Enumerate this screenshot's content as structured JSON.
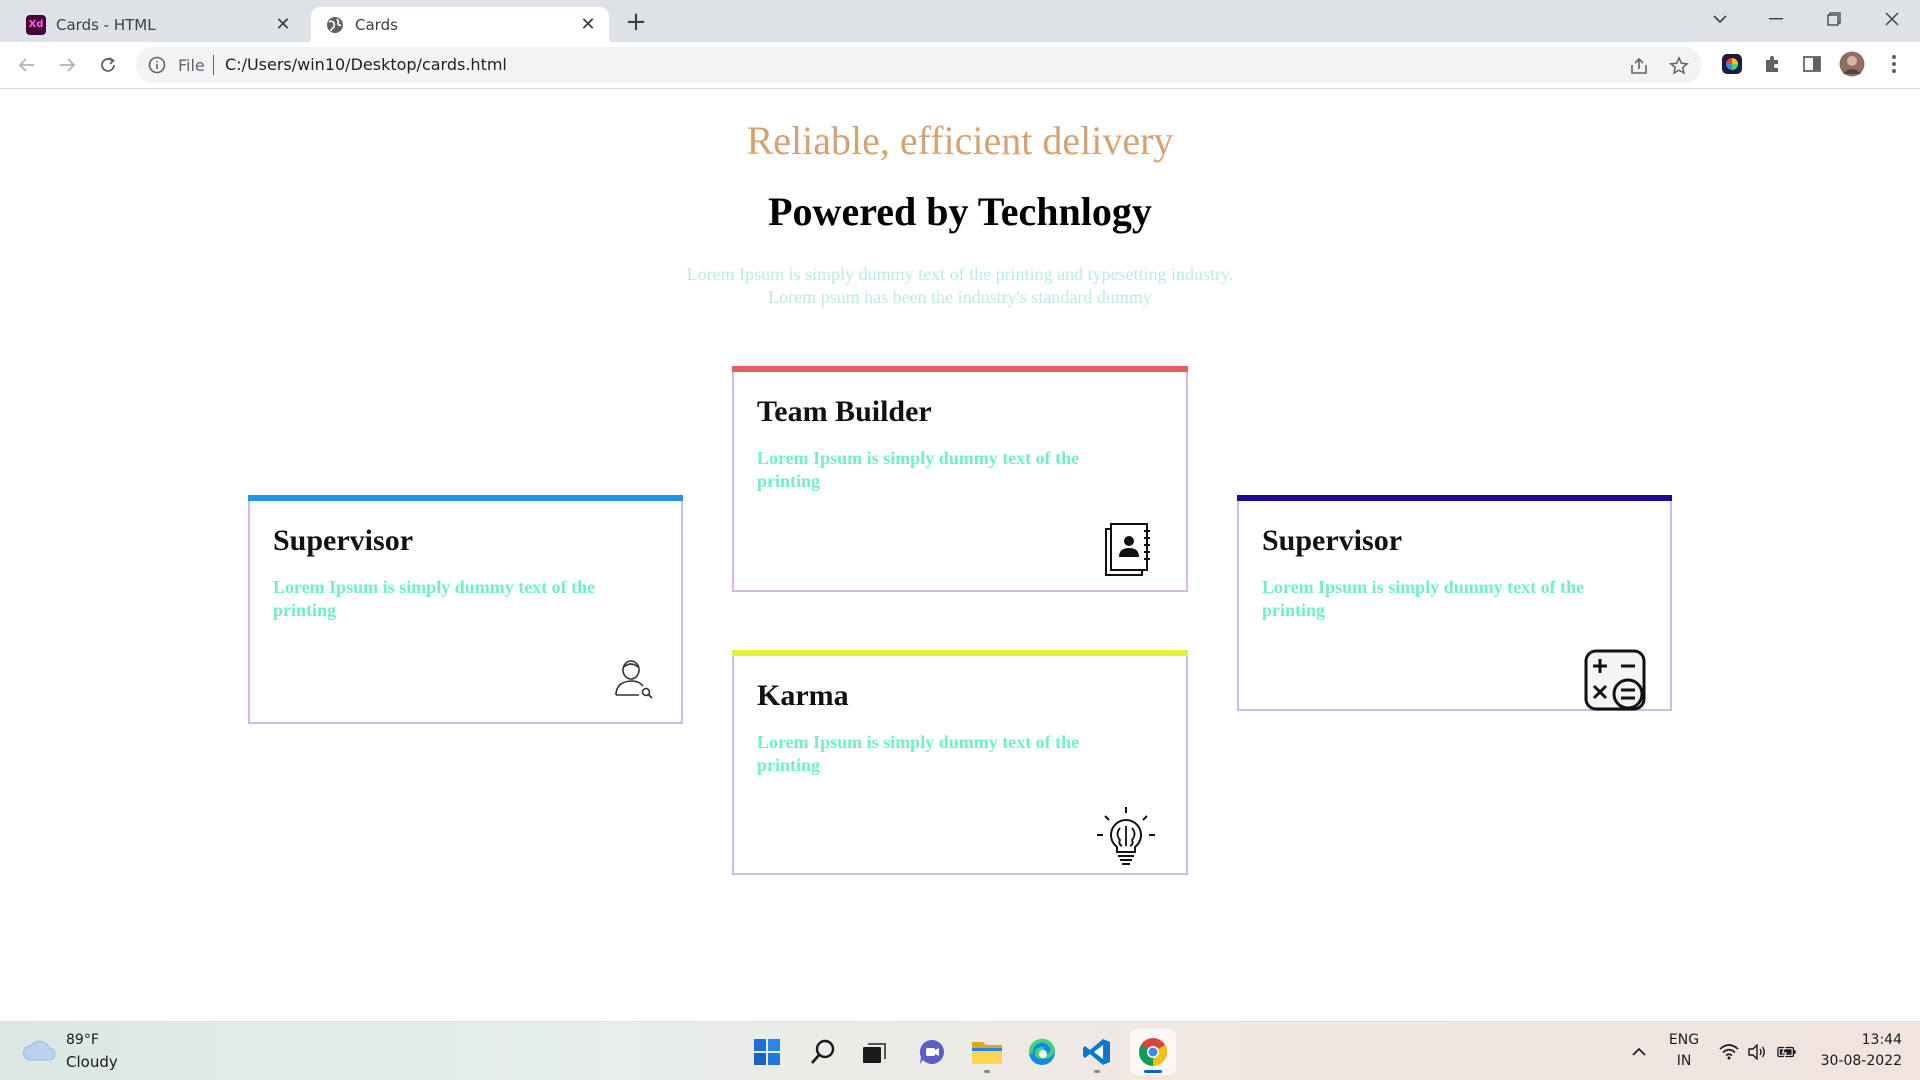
{
  "browser": {
    "tabs": [
      {
        "title": "Cards - HTML",
        "favicon": "adobe-xd-icon",
        "favicon_text": "Xd",
        "active": false
      },
      {
        "title": "Cards",
        "favicon": "globe-icon",
        "active": true
      }
    ],
    "address_bar": {
      "scheme_label": "File",
      "url": "C:/Users/win10/Desktop/cards.html"
    }
  },
  "page": {
    "tagline": "Reliable, efficient delivery",
    "headline": "Powered by Technlogy",
    "intro_lines": [
      "Lorem Ipsum is simply dummy text of the printing and typesetting industry.",
      "Lorem psum has been the industry's standard dummy"
    ],
    "cards": [
      {
        "title": "Supervisor",
        "text": "Lorem Ipsum is simply dummy text of the printing",
        "accent": "#2196e8",
        "icon": "user-search-icon"
      },
      {
        "title": "Team Builder",
        "text": "Lorem Ipsum is simply dummy text of the printing",
        "accent": "#e35f5f",
        "icon": "contact-book-icon"
      },
      {
        "title": "Karma",
        "text": "Lorem Ipsum is simply dummy text of the printing",
        "accent": "#dff23a",
        "icon": "idea-bulb-icon"
      },
      {
        "title": "Supervisor",
        "text": "Lorem Ipsum is simply dummy text of the printing",
        "accent": "#1a0b8f",
        "icon": "calculator-icon"
      }
    ]
  },
  "taskbar": {
    "weather": {
      "temperature": "89°F",
      "condition": "Cloudy",
      "icon": "cloud-icon"
    },
    "apps": [
      "windows-start-icon",
      "search-icon",
      "task-view-icon",
      "teams-chat-icon",
      "file-explorer-icon",
      "edge-icon",
      "vscode-icon",
      "chrome-icon"
    ],
    "tray": {
      "language_line1": "ENG",
      "language_line2": "IN",
      "time": "13:44",
      "date": "30-08-2022"
    }
  },
  "colors": {
    "tagline": "#d4a373",
    "intro_text": "#b9ece6",
    "card_text": "#6ff0c6",
    "card_border": "#d6b8ef"
  }
}
